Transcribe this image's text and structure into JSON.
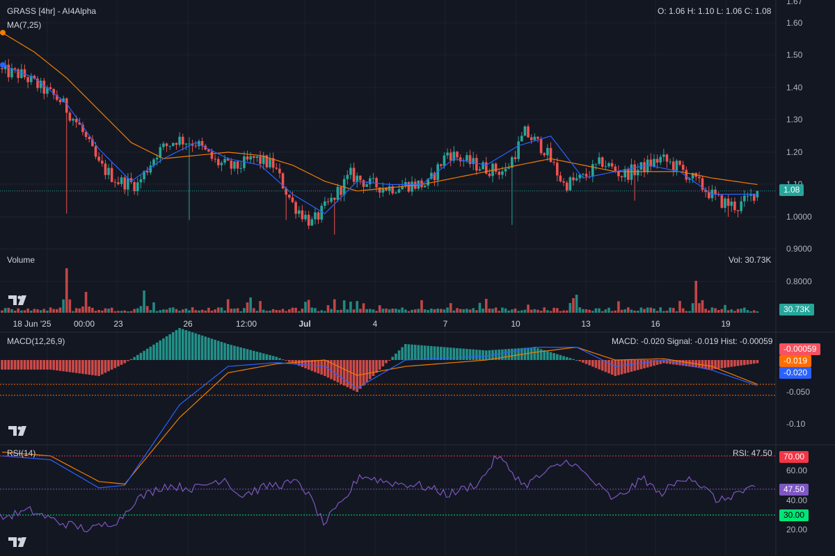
{
  "header": {
    "title": "GRASS [4hr] - AI4Alpha",
    "ohlc": "O: 1.06 H: 1.10 L: 1.06 C: 1.08",
    "ma_label": "MA(7,25)"
  },
  "volume_panel": {
    "label": "Volume",
    "value_text": "Vol: 30.73K",
    "badge": "30.73K"
  },
  "macd_panel": {
    "label": "MACD(12,26,9)",
    "value_text": "MACD: -0.020 Signal: -0.019 Hist: -0.00059",
    "badges": {
      "hist": "-0.00059",
      "signal": "-0.019",
      "macd": "-0.020"
    }
  },
  "rsi_panel": {
    "label": "RSI(14)",
    "value_text": "RSI: 47.50",
    "badges": {
      "upper": "70.00",
      "current": "47.50",
      "lower": "30.00"
    }
  },
  "price_axis": {
    "ticks": [
      "1.67",
      "1.60",
      "1.50",
      "1.40",
      "1.30",
      "1.20",
      "1.10",
      "1.0000",
      "0.9000",
      "0.8000"
    ],
    "last_price_badge": "1.08"
  },
  "macd_axis": {
    "ticks": [
      "-0.050",
      "-0.10"
    ]
  },
  "rsi_axis": {
    "ticks": [
      "60.00",
      "40.00",
      "20.00"
    ]
  },
  "time_axis": {
    "ticks": [
      "18 Jun '25",
      "00:00",
      "23",
      "26",
      "12:00",
      "Jul",
      "4",
      "7",
      "10",
      "13",
      "16",
      "19"
    ]
  },
  "colors": {
    "background": "#131722",
    "up": "#26a69a",
    "down": "#ef5350",
    "ma_fast": "#2962ff",
    "ma_slow": "#f57c00",
    "rsi_line": "#7e57c2",
    "rsi_upper_badge": "#f23645",
    "rsi_lower_badge": "#00e676",
    "last_price_badge": "#26a69a"
  },
  "chart_data": {
    "type": "candlestick",
    "symbol": "GRASS",
    "interval": "4hr",
    "price_range": [
      0.8,
      1.67
    ],
    "last": {
      "open": 1.06,
      "high": 1.1,
      "low": 1.06,
      "close": 1.08,
      "volume": "30.73K"
    },
    "close_path": [
      [
        0,
        1.45
      ],
      [
        6,
        1.44
      ],
      [
        12,
        1.4
      ],
      [
        18,
        1.36
      ],
      [
        24,
        1.28
      ],
      [
        30,
        1.16
      ],
      [
        36,
        1.11
      ],
      [
        42,
        1.1
      ],
      [
        48,
        1.2
      ],
      [
        54,
        1.24
      ],
      [
        60,
        1.23
      ],
      [
        66,
        1.17
      ],
      [
        72,
        1.15
      ],
      [
        78,
        1.18
      ],
      [
        84,
        1.16
      ],
      [
        90,
        1.04
      ],
      [
        96,
        0.98
      ],
      [
        102,
        1.05
      ],
      [
        108,
        1.13
      ],
      [
        114,
        1.1
      ],
      [
        120,
        1.09
      ],
      [
        126,
        1.1
      ],
      [
        132,
        1.1
      ],
      [
        138,
        1.2
      ],
      [
        144,
        1.17
      ],
      [
        150,
        1.15
      ],
      [
        156,
        1.14
      ],
      [
        162,
        1.26
      ],
      [
        168,
        1.21
      ],
      [
        174,
        1.1
      ],
      [
        180,
        1.12
      ],
      [
        186,
        1.17
      ],
      [
        192,
        1.13
      ],
      [
        198,
        1.15
      ],
      [
        204,
        1.18
      ],
      [
        210,
        1.15
      ],
      [
        216,
        1.1
      ],
      [
        222,
        1.05
      ],
      [
        228,
        1.03
      ],
      [
        234,
        1.08
      ]
    ],
    "ma_fast_path": [
      [
        0,
        1.47
      ],
      [
        10,
        1.43
      ],
      [
        20,
        1.35
      ],
      [
        30,
        1.21
      ],
      [
        40,
        1.11
      ],
      [
        50,
        1.18
      ],
      [
        60,
        1.23
      ],
      [
        70,
        1.18
      ],
      [
        80,
        1.16
      ],
      [
        90,
        1.07
      ],
      [
        100,
        1.01
      ],
      [
        110,
        1.11
      ],
      [
        120,
        1.1
      ],
      [
        130,
        1.1
      ],
      [
        140,
        1.18
      ],
      [
        150,
        1.16
      ],
      [
        160,
        1.22
      ],
      [
        170,
        1.25
      ],
      [
        180,
        1.12
      ],
      [
        190,
        1.14
      ],
      [
        200,
        1.16
      ],
      [
        210,
        1.14
      ],
      [
        220,
        1.07
      ],
      [
        234,
        1.07
      ]
    ],
    "ma_slow_path": [
      [
        0,
        1.57
      ],
      [
        10,
        1.51
      ],
      [
        20,
        1.43
      ],
      [
        30,
        1.33
      ],
      [
        40,
        1.23
      ],
      [
        50,
        1.18
      ],
      [
        60,
        1.19
      ],
      [
        70,
        1.2
      ],
      [
        80,
        1.19
      ],
      [
        90,
        1.16
      ],
      [
        100,
        1.11
      ],
      [
        110,
        1.08
      ],
      [
        120,
        1.09
      ],
      [
        130,
        1.1
      ],
      [
        140,
        1.12
      ],
      [
        150,
        1.14
      ],
      [
        160,
        1.16
      ],
      [
        170,
        1.18
      ],
      [
        180,
        1.16
      ],
      [
        190,
        1.14
      ],
      [
        200,
        1.14
      ],
      [
        210,
        1.14
      ],
      [
        220,
        1.12
      ],
      [
        234,
        1.1
      ]
    ],
    "volume_spikes": [
      [
        20,
        3.2
      ],
      [
        26,
        1.5
      ],
      [
        44,
        1.6
      ],
      [
        77,
        1.1
      ],
      [
        108,
        0.8
      ],
      [
        150,
        1.0
      ],
      [
        178,
        1.3
      ],
      [
        215,
        2.3
      ]
    ],
    "macd": {
      "range": [
        -0.12,
        0.02
      ],
      "macd_path": [
        [
          0,
          -0.075
        ],
        [
          15,
          -0.078
        ],
        [
          30,
          -0.1
        ],
        [
          38,
          -0.098
        ],
        [
          55,
          -0.035
        ],
        [
          70,
          -0.005
        ],
        [
          85,
          -0.002
        ],
        [
          100,
          -0.005
        ],
        [
          110,
          -0.022
        ],
        [
          125,
          0.0
        ],
        [
          150,
          0.003
        ],
        [
          165,
          0.01
        ],
        [
          178,
          0.01
        ],
        [
          190,
          -0.005
        ],
        [
          205,
          0.0
        ],
        [
          220,
          -0.008
        ],
        [
          234,
          -0.02
        ]
      ],
      "signal_path": [
        [
          0,
          -0.072
        ],
        [
          15,
          -0.075
        ],
        [
          30,
          -0.095
        ],
        [
          38,
          -0.097
        ],
        [
          55,
          -0.045
        ],
        [
          70,
          -0.01
        ],
        [
          85,
          -0.003
        ],
        [
          100,
          -0.0
        ],
        [
          110,
          -0.012
        ],
        [
          125,
          -0.005
        ],
        [
          150,
          0.0
        ],
        [
          165,
          0.006
        ],
        [
          178,
          0.01
        ],
        [
          190,
          0.0
        ],
        [
          205,
          0.001
        ],
        [
          220,
          -0.005
        ],
        [
          234,
          -0.019
        ]
      ],
      "last": {
        "macd": -0.02,
        "signal": -0.019,
        "hist": -0.00059
      }
    },
    "rsi": {
      "range": [
        15,
        75
      ],
      "levels": {
        "upper": 70,
        "lower": 30
      },
      "path": [
        [
          0,
          28
        ],
        [
          10,
          33
        ],
        [
          20,
          25
        ],
        [
          30,
          20
        ],
        [
          40,
          27
        ],
        [
          45,
          40
        ],
        [
          55,
          50
        ],
        [
          65,
          48
        ],
        [
          75,
          55
        ],
        [
          80,
          43
        ],
        [
          90,
          50
        ],
        [
          100,
          52
        ],
        [
          104,
          40
        ],
        [
          108,
          24
        ],
        [
          115,
          40
        ],
        [
          120,
          57
        ],
        [
          130,
          52
        ],
        [
          140,
          50
        ],
        [
          150,
          44
        ],
        [
          160,
          52
        ],
        [
          166,
          70
        ],
        [
          175,
          50
        ],
        [
          185,
          62
        ],
        [
          190,
          67
        ],
        [
          195,
          58
        ],
        [
          205,
          40
        ],
        [
          215,
          55
        ],
        [
          220,
          44
        ],
        [
          230,
          57
        ],
        [
          240,
          39
        ],
        [
          246,
          45
        ],
        [
          252,
          47.5
        ]
      ],
      "last": 47.5
    }
  }
}
